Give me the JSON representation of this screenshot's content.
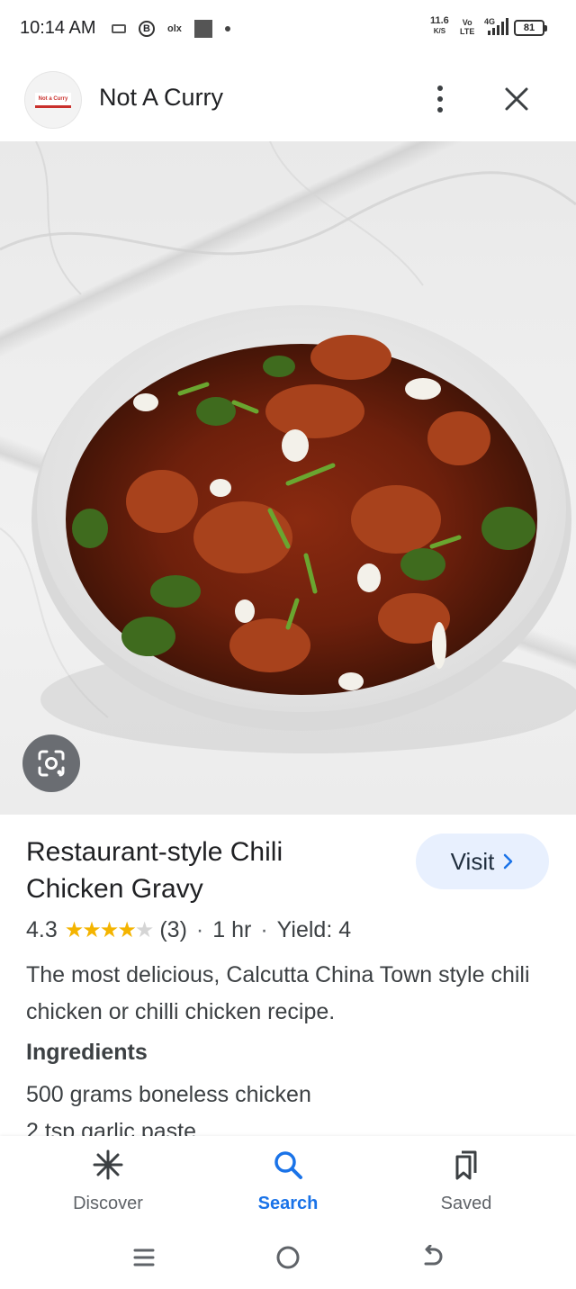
{
  "status_bar": {
    "time": "10:14 AM",
    "net_speed_value": "11.6",
    "net_speed_unit": "K/S",
    "volte_top": "Vo",
    "volte_bottom": "LTE",
    "network": "4G",
    "battery": "81"
  },
  "header": {
    "site_name": "Not A Curry",
    "favicon_text": "Not a Curry",
    "more_icon": "more-vert-icon",
    "close_icon": "close-icon"
  },
  "hero": {
    "lens_icon": "google-lens-icon"
  },
  "recipe": {
    "title_line1": "Restaurant-style Chili",
    "title_line2": "Chicken Gravy",
    "visit_label": "Visit",
    "rating": "4.3",
    "rating_stars": 4.3,
    "review_count": "(3)",
    "time": "1 hr",
    "yield": "Yield: 4",
    "description": "The most delicious, Calcutta China Town style chili chicken or chilli chicken recipe.",
    "ingredients_heading": "Ingredients",
    "ingredients": [
      "500 grams boneless chicken",
      "2 tsp garlic paste"
    ]
  },
  "bottom_nav": {
    "items": [
      {
        "label": "Discover",
        "icon": "asterisk-icon",
        "active": false
      },
      {
        "label": "Search",
        "icon": "search-icon",
        "active": true
      },
      {
        "label": "Saved",
        "icon": "bookmarks-icon",
        "active": false
      }
    ]
  },
  "colors": {
    "accent": "#1a73e8",
    "star": "#f4b400",
    "visit_bg": "#e8f0fe",
    "text": "#202124"
  }
}
